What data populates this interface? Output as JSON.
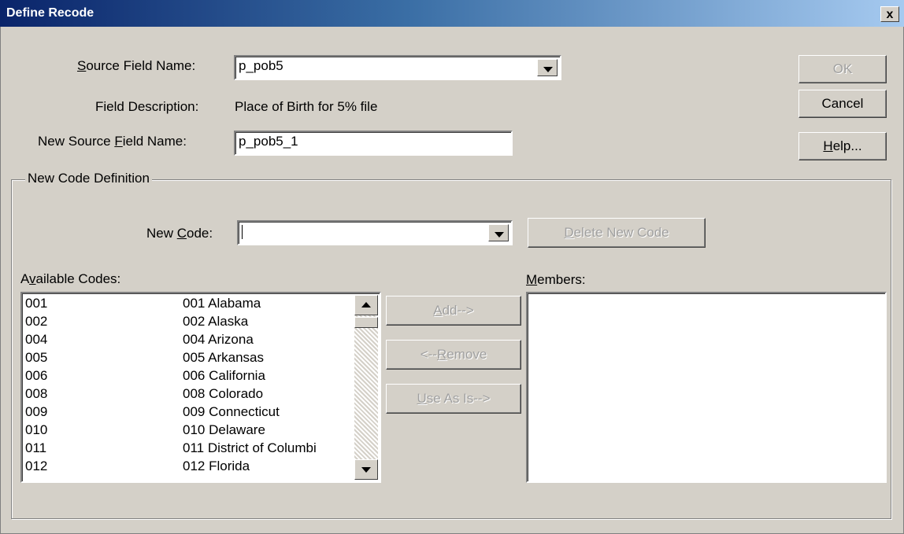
{
  "window": {
    "title": "Define Recode",
    "close_label": "x"
  },
  "source_field": {
    "label": "Source Field Name:",
    "value": "p_pob5"
  },
  "field_description": {
    "label": "Field Description:",
    "value": "Place of Birth for 5% file"
  },
  "new_source_field": {
    "label": "New Source Field Name:",
    "value": "p_pob5_1"
  },
  "buttons": {
    "ok": "OK",
    "cancel": "Cancel",
    "help": "Help..."
  },
  "new_code_definition": {
    "group_label": "New Code Definition",
    "new_code_label": "New Code:",
    "new_code_value": "",
    "delete_button": "Delete New Code",
    "available_label": "Available Codes:",
    "members_label": "Members:",
    "add_button": "Add-->",
    "remove_button": "<--Remove",
    "use_as_is_button": "Use As Is-->",
    "available_codes": [
      {
        "code": "001",
        "desc": "001 Alabama"
      },
      {
        "code": "002",
        "desc": "002 Alaska"
      },
      {
        "code": "004",
        "desc": "004 Arizona"
      },
      {
        "code": "005",
        "desc": "005 Arkansas"
      },
      {
        "code": "006",
        "desc": "006 California"
      },
      {
        "code": "008",
        "desc": "008 Colorado"
      },
      {
        "code": "009",
        "desc": "009 Connecticut"
      },
      {
        "code": "010",
        "desc": "010 Delaware"
      },
      {
        "code": "011",
        "desc": "011 District of Columbi"
      },
      {
        "code": "012",
        "desc": "012 Florida"
      }
    ]
  }
}
